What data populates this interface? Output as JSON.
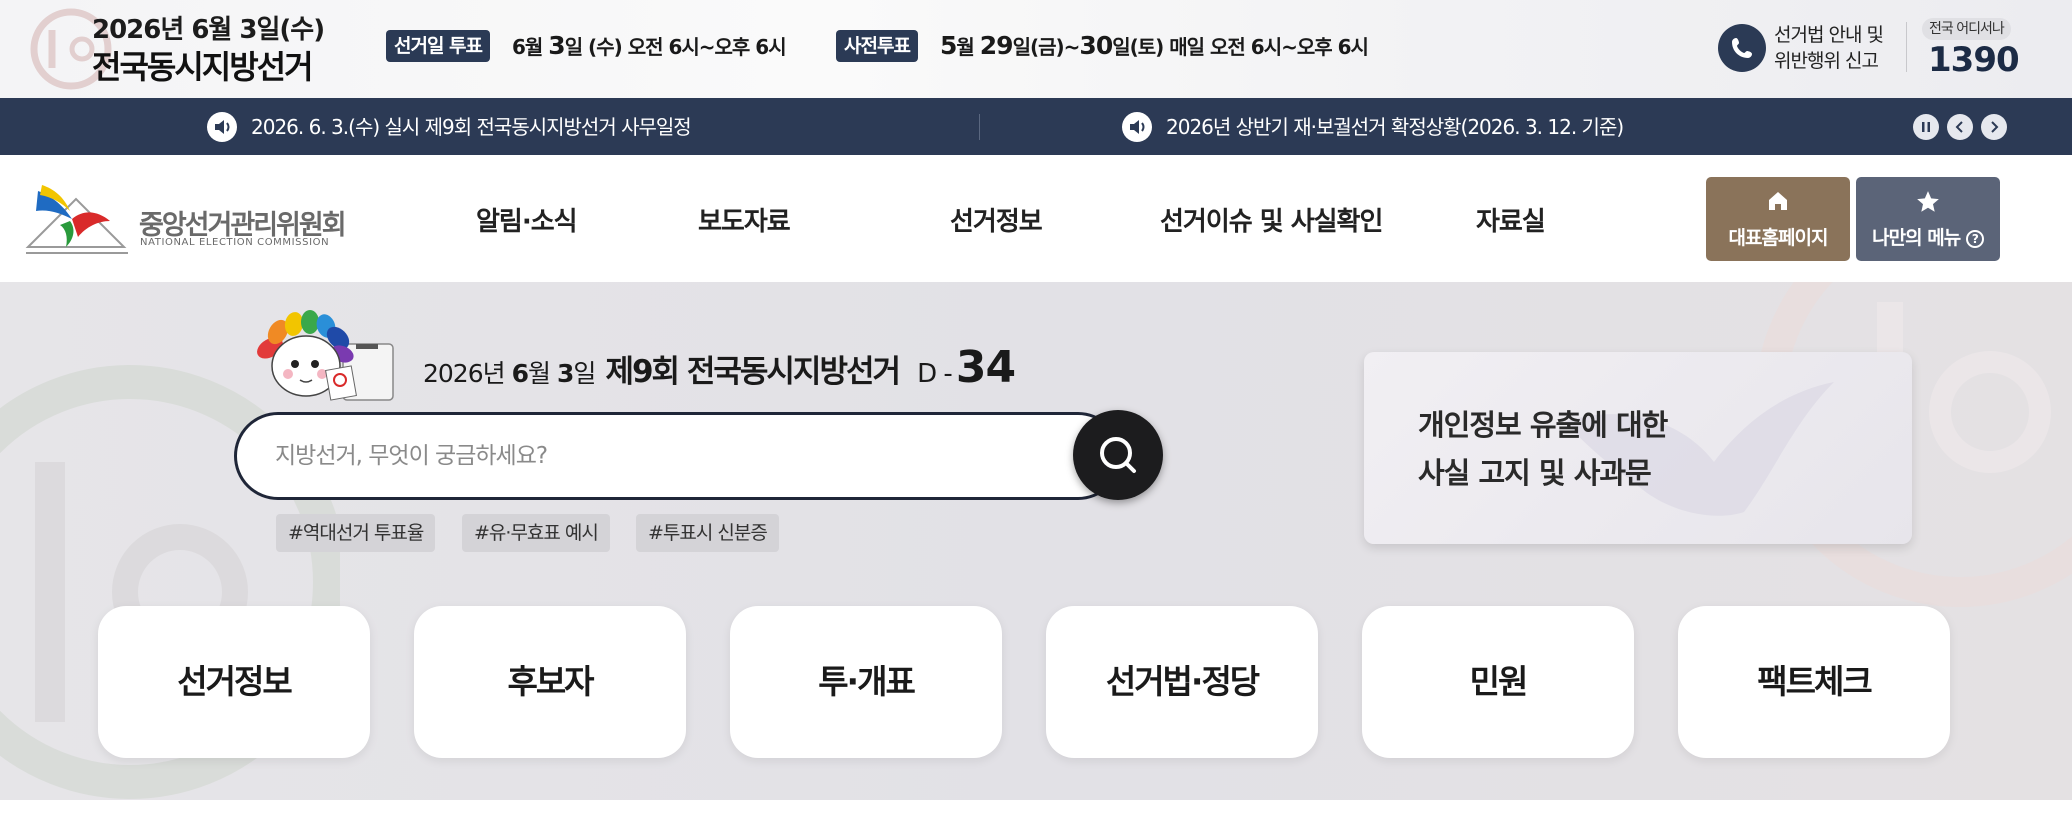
{
  "topbar": {
    "date": "2026년 6월 3일(수)",
    "title": "전국동시지방선거",
    "election_day_badge": "선거일 투표",
    "election_day_text_a": "6월 ",
    "election_day_text_b": "3",
    "election_day_text_c": "일 (수) 오전 6시~오후 6시",
    "early_vote_badge": "사전투표",
    "early_vote_text_a": "5",
    "early_vote_text_b": "월 ",
    "early_vote_text_c": "29",
    "early_vote_text_d": "일(금)~",
    "early_vote_text_e": "30",
    "early_vote_text_f": "일(토) 매일 오전 6시~오후 6시",
    "report_line1": "선거법 안내 및",
    "report_line2": "위반행위 신고",
    "hotline_label": "전국 어디서나",
    "hotline_number": "1390"
  },
  "noticebar": {
    "left_text": "2026. 6. 3.(수) 실시 제9회 전국동시지방선거 사무일정",
    "right_text": "2026년 상반기 재·보궐선거 확정상황(2026. 3. 12. 기준)"
  },
  "header": {
    "logo_ko": "중앙선거관리위원회",
    "logo_en": "NATIONAL ELECTION COMMISSION",
    "nav": [
      "알림·소식",
      "보도자료",
      "선거정보",
      "선거이슈 및 사실확인",
      "자료실"
    ],
    "home_button": "대표홈페이지",
    "mymenu_button": "나만의 메뉴"
  },
  "hero": {
    "date_a": "2026년 ",
    "date_b": "6",
    "date_c": "월 ",
    "date_d": "3",
    "date_e": "일",
    "title": "제9회 전국동시지방선거",
    "dday_label": "D -",
    "dday_number": "34",
    "search_placeholder": "지방선거, 무엇이 궁금하세요?",
    "tags": [
      "#역대선거 투표율",
      "#유·무효표 예시",
      "#투표시 신분증"
    ],
    "notice_line1": "개인정보 유출에 대한",
    "notice_line2": "사실 고지 및 사과문"
  },
  "quick_menu": [
    "선거정보",
    "후보자",
    "투·개표",
    "선거법·정당",
    "민원",
    "팩트체크"
  ],
  "colors": {
    "navy": "#2c3a55",
    "brown_button": "#8a735a",
    "slate_button": "#5b6478"
  }
}
